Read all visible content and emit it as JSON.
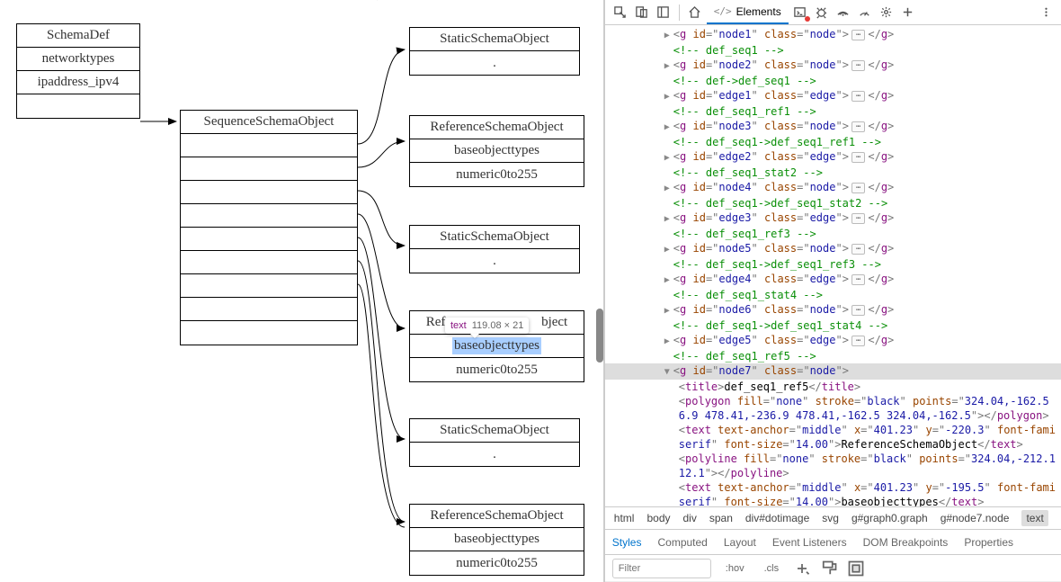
{
  "diagram": {
    "schemadef": {
      "title": "SchemaDef",
      "r1": "networktypes",
      "r2": "ipaddress_ipv4"
    },
    "sequence": {
      "title": "SequenceSchemaObject"
    },
    "static": {
      "title": "StaticSchemaObject",
      "dot": "."
    },
    "reference": {
      "title": "ReferenceSchemaObject",
      "r1": "baseobjecttypes",
      "r2": "numeric0to255"
    },
    "ref_partial_left": "Refe",
    "ref_partial_right": "bject"
  },
  "tooltip": {
    "tag": "text",
    "dim": "119.08 × 21"
  },
  "toolbar": {
    "elements_tab": "Elements"
  },
  "dom": {
    "rows": [
      {
        "kind": "node",
        "d": 1,
        "id": "node1",
        "cls": "node"
      },
      {
        "kind": "cmt",
        "d": 1,
        "txt": " def_seq1 "
      },
      {
        "kind": "node",
        "d": 1,
        "id": "node2",
        "cls": "node"
      },
      {
        "kind": "cmt",
        "d": 1,
        "txt": " def&#45;&gt;def_seq1 "
      },
      {
        "kind": "node",
        "d": 1,
        "id": "edge1",
        "cls": "edge"
      },
      {
        "kind": "cmt",
        "d": 1,
        "txt": " def_seq1_ref1 "
      },
      {
        "kind": "node",
        "d": 1,
        "id": "node3",
        "cls": "node"
      },
      {
        "kind": "cmt",
        "d": 1,
        "txt": " def_seq1&#45;&gt;def_seq1_ref1 "
      },
      {
        "kind": "node",
        "d": 1,
        "id": "edge2",
        "cls": "edge"
      },
      {
        "kind": "cmt",
        "d": 1,
        "txt": " def_seq1_stat2 "
      },
      {
        "kind": "node",
        "d": 1,
        "id": "node4",
        "cls": "node"
      },
      {
        "kind": "cmt",
        "d": 1,
        "txt": " def_seq1&#45;&gt;def_seq1_stat2 "
      },
      {
        "kind": "node",
        "d": 1,
        "id": "edge3",
        "cls": "edge"
      },
      {
        "kind": "cmt",
        "d": 1,
        "txt": " def_seq1_ref3 "
      },
      {
        "kind": "node",
        "d": 1,
        "id": "node5",
        "cls": "node"
      },
      {
        "kind": "cmt",
        "d": 1,
        "txt": " def_seq1&#45;&gt;def_seq1_ref3 "
      },
      {
        "kind": "node",
        "d": 1,
        "id": "edge4",
        "cls": "edge"
      },
      {
        "kind": "cmt",
        "d": 1,
        "txt": " def_seq1_stat4 "
      },
      {
        "kind": "node",
        "d": 1,
        "id": "node6",
        "cls": "node"
      },
      {
        "kind": "cmt",
        "d": 1,
        "txt": " def_seq1&#45;&gt;def_seq1_stat4 "
      },
      {
        "kind": "node",
        "d": 1,
        "id": "edge5",
        "cls": "edge"
      },
      {
        "kind": "cmt",
        "d": 1,
        "txt": " def_seq1_ref5 "
      },
      {
        "kind": "open",
        "d": 1,
        "id": "node7",
        "cls": "node",
        "sel": true
      },
      {
        "kind": "title",
        "d": 2,
        "txt": "def_seq1_ref5"
      },
      {
        "kind": "polygon",
        "d": 2,
        "fill": "none",
        "stroke": "black",
        "points": "324.04,-162.5\n6.9 478.41,-236.9 478.41,-162.5 324.04,-162.5"
      },
      {
        "kind": "text",
        "d": 2,
        "anchor": "middle",
        "x": "401.23",
        "y": "-220.3",
        "ff": "\nserif",
        "fs": "14.00",
        "txt": "ReferenceSchemaObject"
      },
      {
        "kind": "polyline",
        "d": 2,
        "fill": "none",
        "stroke": "black",
        "points": "324.04,-212.1\n12.1"
      },
      {
        "kind": "text2",
        "d": 2,
        "anchor": "middle",
        "x": "401.23",
        "y": "-195.5",
        "ff": "\nserif",
        "fs": "14.00",
        "txt": "baseobjecttypes"
      }
    ]
  },
  "breadcrumb": [
    "html",
    "body",
    "div",
    "span",
    "div#dotimage",
    "svg",
    "g#graph0.graph",
    "g#node7.node",
    "text"
  ],
  "subtabs": [
    "Styles",
    "Computed",
    "Layout",
    "Event Listeners",
    "DOM Breakpoints",
    "Properties"
  ],
  "styles": {
    "filter_placeholder": "Filter",
    "hov": ":hov",
    "cls": ".cls"
  }
}
